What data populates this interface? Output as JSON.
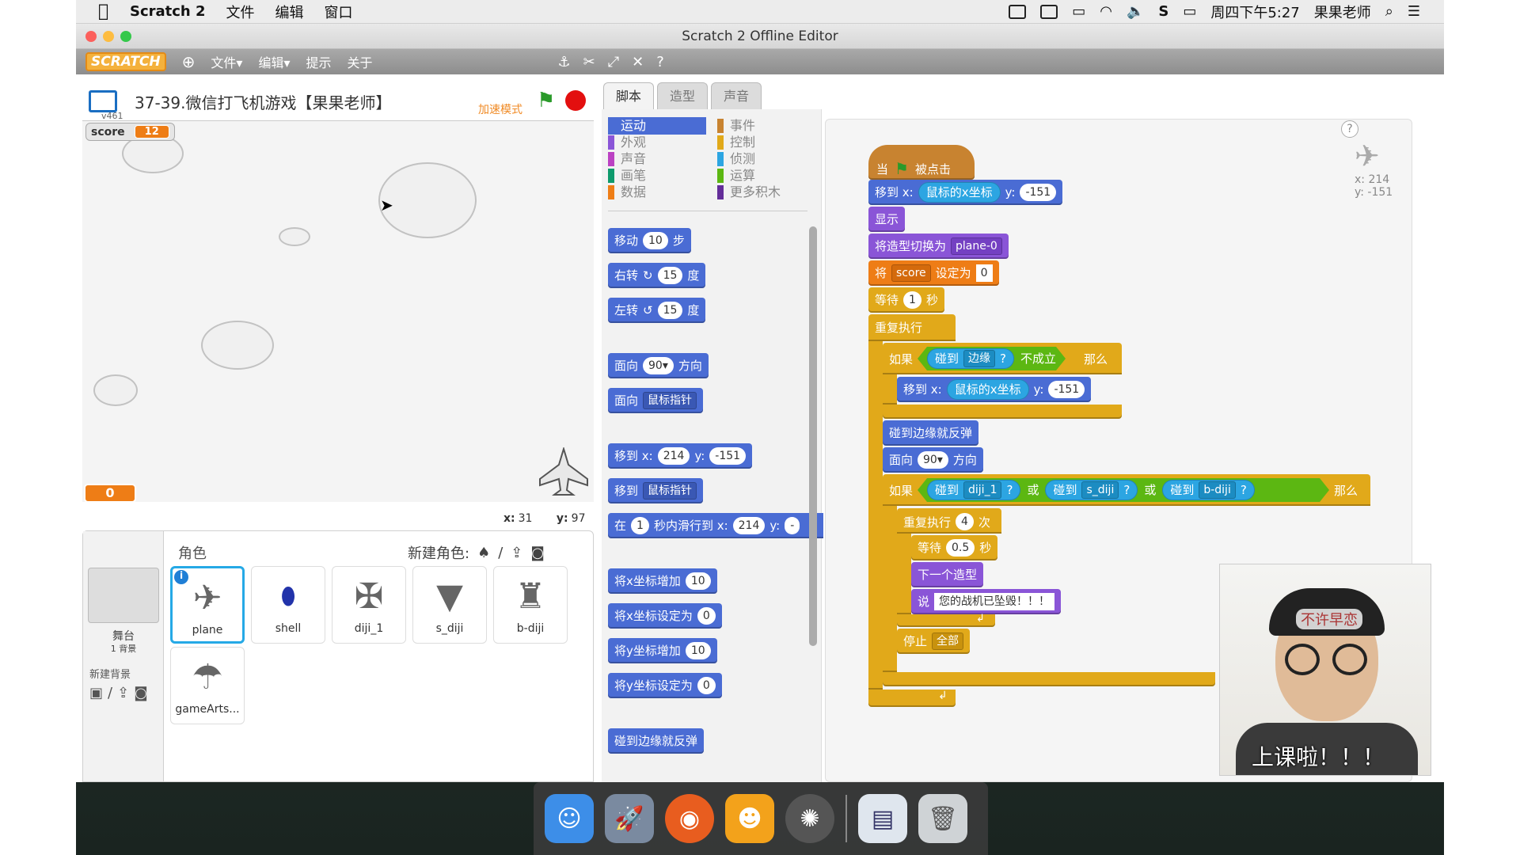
{
  "menubar": {
    "app_name": "Scratch 2",
    "menus": [
      "文件",
      "编辑",
      "窗口"
    ],
    "clock": "周四下午5:27",
    "user": "果果老师"
  },
  "window": {
    "title": "Scratch 2 Offline Editor"
  },
  "toolbar": {
    "logo": "SCRATCH",
    "menus": [
      "文件▾",
      "编辑▾",
      "提示",
      "关于"
    ]
  },
  "stage": {
    "project_title": "37-39.微信打飞机游戏【果果老师】",
    "version": "v461",
    "turbo": "加速模式",
    "monitor_label": "score",
    "monitor_value": "12",
    "big_monitor_value": "0",
    "mouse_x_label": "x:",
    "mouse_x": "31",
    "mouse_y_label": "y:",
    "mouse_y": "97"
  },
  "sprites": {
    "header": "角色",
    "new_sprite": "新建角色:",
    "stage_label": "舞台",
    "stage_sub": "1 背景",
    "new_backdrop": "新建背景",
    "items": [
      {
        "name": "plane",
        "icon": "plane-icon"
      },
      {
        "name": "shell",
        "icon": "shell-icon"
      },
      {
        "name": "diji_1",
        "icon": "enemy-icon"
      },
      {
        "name": "s_diji",
        "icon": "enemy-icon"
      },
      {
        "name": "b-diji",
        "icon": "enemy-icon"
      },
      {
        "name": "gameArts...",
        "icon": "parachute-icon"
      }
    ]
  },
  "tabs": [
    "脚本",
    "造型",
    "声音"
  ],
  "categories": {
    "left": [
      {
        "label": "运动",
        "color": "#4a6cd4"
      },
      {
        "label": "外观",
        "color": "#8a55d7"
      },
      {
        "label": "声音",
        "color": "#bb42c3"
      },
      {
        "label": "画笔",
        "color": "#0e9a6c"
      },
      {
        "label": "数据",
        "color": "#ee7d16"
      }
    ],
    "right": [
      {
        "label": "事件",
        "color": "#c88330"
      },
      {
        "label": "控制",
        "color": "#e1a91a"
      },
      {
        "label": "侦测",
        "color": "#2ca5e2"
      },
      {
        "label": "运算",
        "color": "#5cb712"
      },
      {
        "label": "更多积木",
        "color": "#632d99"
      }
    ]
  },
  "palette": {
    "move": "移动",
    "move_n": "10",
    "steps": "步",
    "turn_right": "右转",
    "turn_n": "15",
    "degrees": "度",
    "turn_left": "左转",
    "turn_left_n": "15",
    "point_dir": "面向",
    "point_dir_n": "90▾",
    "direction": "方向",
    "point_towards": "面向",
    "mouse_pointer": "鼠标指针",
    "goto_xy": "移到 x:",
    "goto_x": "214",
    "goto_y_label": "y:",
    "goto_y": "-151",
    "goto": "移到",
    "goto_target": "鼠标指针",
    "glide": "在",
    "glide_secs": "1",
    "glide_text": "秒内滑行到 x:",
    "glide_x": "214",
    "glide_y_label": "y:",
    "glide_y": "-",
    "change_x": "将x坐标增加",
    "change_x_n": "10",
    "set_x": "将x坐标设定为",
    "set_x_n": "0",
    "change_y": "将y坐标增加",
    "change_y_n": "10",
    "set_y": "将y坐标设定为",
    "set_y_n": "0",
    "bounce": "碰到边缘就反弹"
  },
  "script": {
    "when": "当",
    "clicked": "被点击",
    "goto": "移到 x:",
    "mouse_x": "鼠标的x坐标",
    "y_label": "y:",
    "y_val": "-151",
    "show": "显示",
    "switch_costume": "将造型切换为",
    "costume": "plane-0",
    "set_var": "将",
    "var_name": "score",
    "set_to": "设定为",
    "var_value": "0",
    "wait": "等待",
    "wait_1": "1",
    "secs": "秒",
    "forever": "重复执行",
    "if": "如果",
    "touching": "碰到",
    "edge": "边缘",
    "q": "?",
    "not": "不成立",
    "then": "那么",
    "inner_goto": "移到 x:",
    "inner_mouse_x": "鼠标的x坐标",
    "inner_y_label": "y:",
    "inner_y": "-151",
    "bounce": "碰到边缘就反弹",
    "point": "面向",
    "point_n": "90▾",
    "direction": "方向",
    "if2": "如果",
    "diji_1": "diji_1",
    "or": "或",
    "s_diji": "s_diji",
    "b_diji": "b-diji",
    "repeat": "重复执行",
    "repeat_n": "4",
    "times": "次",
    "wait2_n": "0.5",
    "next_costume": "下一个造型",
    "say": "说",
    "say_text": "您的战机已坠毁！！！",
    "stop": "停止",
    "stop_opt": "全部"
  },
  "sprite_info": {
    "x": "x: 214",
    "y": "y: -151"
  },
  "webcam": {
    "sticker": "不许早恋",
    "caption": "上课啦！！！"
  }
}
